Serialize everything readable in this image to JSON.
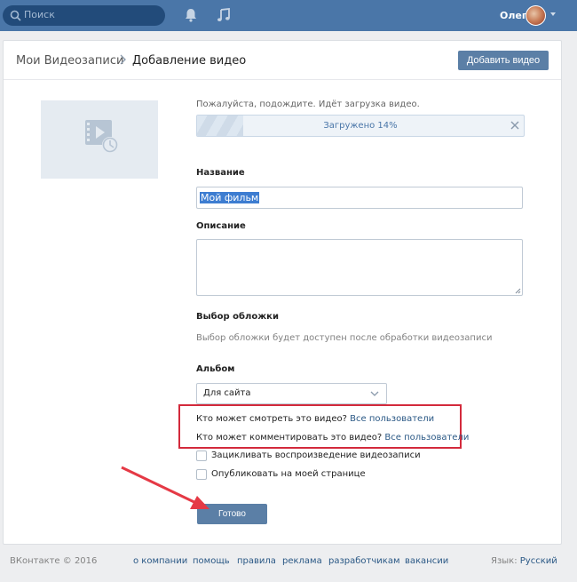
{
  "header": {
    "search_placeholder": "Поиск",
    "user_name": "Олег",
    "icons": [
      "search-icon",
      "bell-icon",
      "music-icon",
      "avatar",
      "chevron-down-icon"
    ]
  },
  "breadcrumb": {
    "parent": "Мои Видеозаписи",
    "current": "Добавление видео"
  },
  "toolbar": {
    "add_video_label": "Добавить видео"
  },
  "upload": {
    "status_text": "Пожалуйста, подождите. Идёт загрузка видео.",
    "progress_label": "Загружено 14%",
    "progress_value": 14
  },
  "form": {
    "title_label": "Название",
    "title_value": "Мой фильм",
    "description_label": "Описание",
    "description_value": "",
    "cover_label": "Выбор обложки",
    "cover_hint": "Выбор обложки будет доступен после обработки видеозаписи",
    "album_label": "Альбом",
    "album_value": "Для сайта",
    "privacy_view_text": "Кто может смотреть это видео?",
    "privacy_view_value": "Все пользователи",
    "privacy_comment_text": "Кто может комментировать это видео?",
    "privacy_comment_value": "Все пользователи",
    "loop_label": "Зацикливать воспроизведение видеозаписи",
    "publish_label": "Опубликовать на моей странице",
    "done_label": "Готово"
  },
  "footer": {
    "copyright": "ВКонтакте © 2016",
    "links": [
      "о компании",
      "помощь",
      "правила",
      "реклама",
      "разработчикам",
      "вакансии"
    ],
    "language_label": "Язык:",
    "language_value": "Русский"
  },
  "colors": {
    "topbar": "#4a76a8",
    "button": "#5b7fa6",
    "link": "#2a5885",
    "highlight_border": "#d32a3c",
    "arrow": "#e53945"
  }
}
